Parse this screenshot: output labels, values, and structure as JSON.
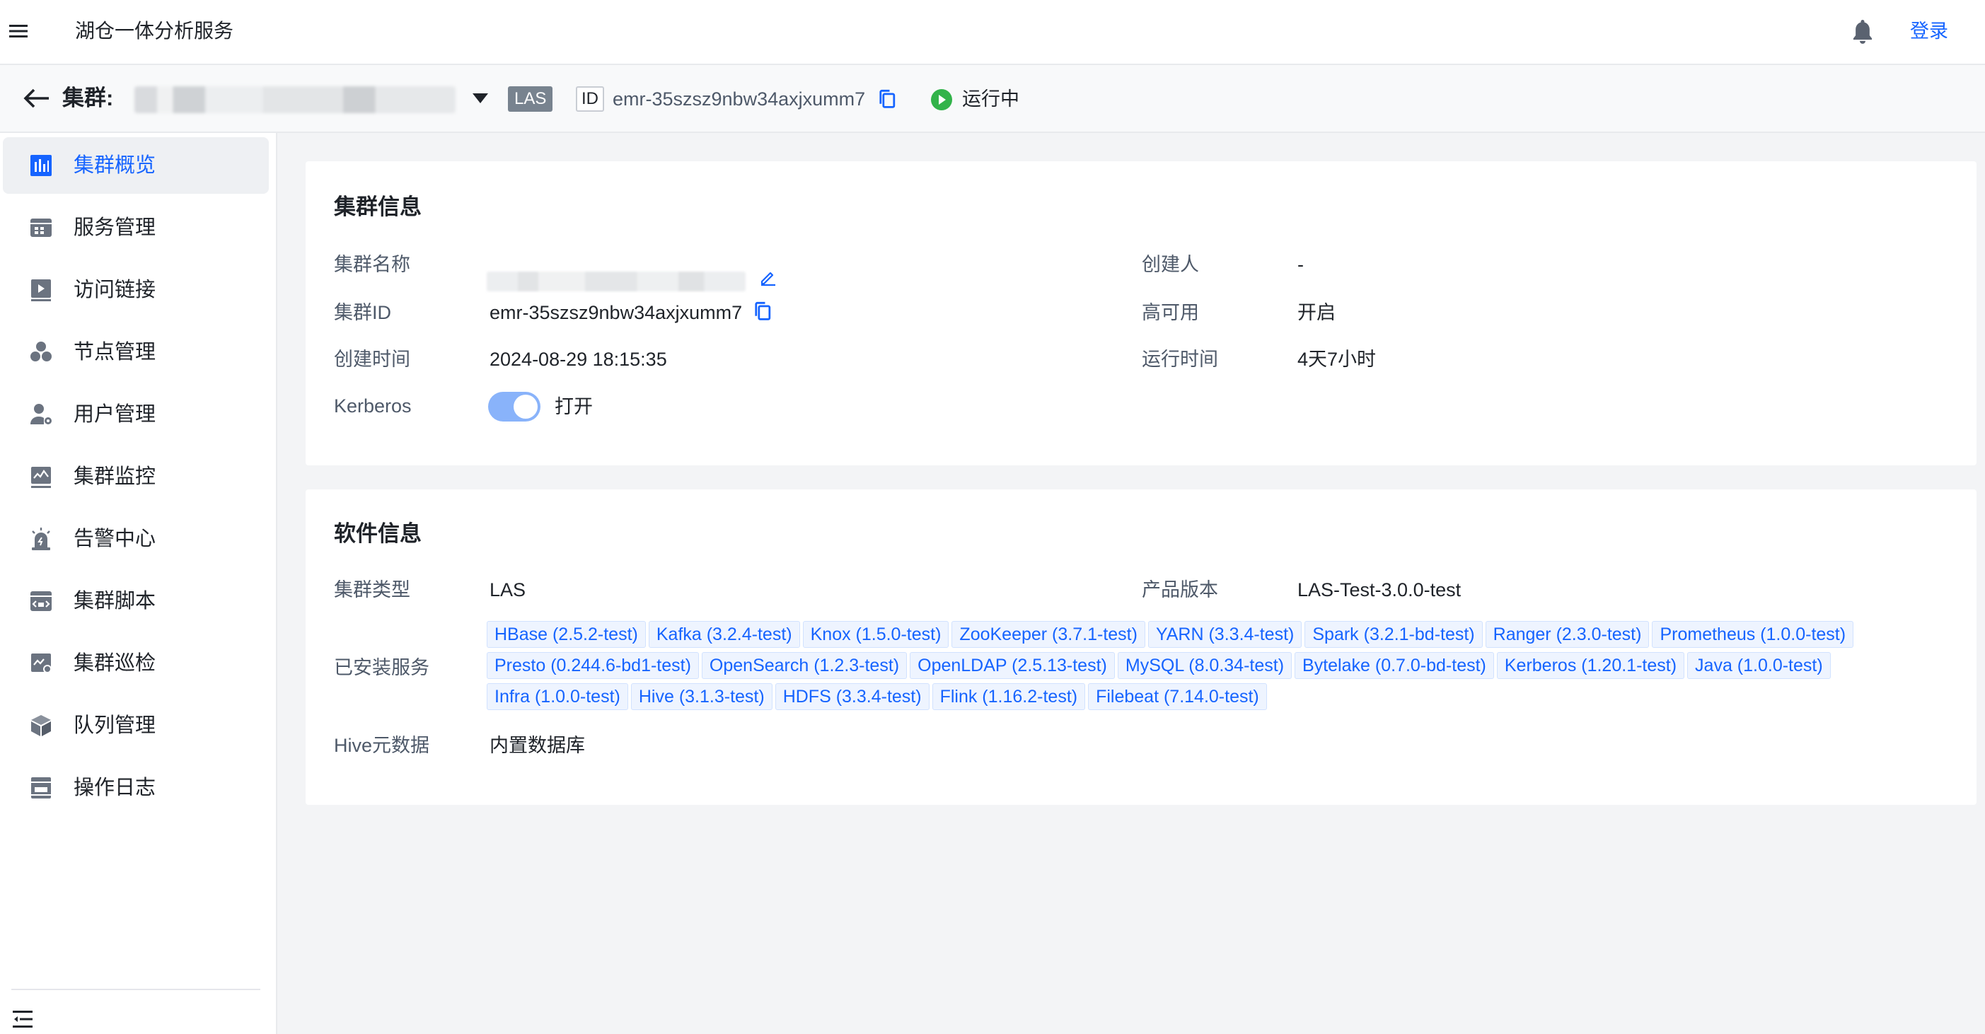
{
  "app": {
    "title": "湖仓一体分析服务",
    "login": "登录"
  },
  "cluster_header": {
    "label": "集群:",
    "type_badge": "LAS",
    "id_badge": "ID",
    "id": "emr-35szsz9nbw34axjxumm7",
    "status": "运行中"
  },
  "sidebar": {
    "items": [
      {
        "label": "集群概览",
        "icon": "chart-bar-icon",
        "active": true
      },
      {
        "label": "服务管理",
        "icon": "service-grid-icon"
      },
      {
        "label": "访问链接",
        "icon": "link-play-icon"
      },
      {
        "label": "节点管理",
        "icon": "nodes-icon"
      },
      {
        "label": "用户管理",
        "icon": "user-gear-icon"
      },
      {
        "label": "集群监控",
        "icon": "monitor-chart-icon"
      },
      {
        "label": "告警中心",
        "icon": "alarm-icon"
      },
      {
        "label": "集群脚本",
        "icon": "script-icon"
      },
      {
        "label": "集群巡检",
        "icon": "inspection-icon"
      },
      {
        "label": "队列管理",
        "icon": "cube-icon"
      },
      {
        "label": "操作日志",
        "icon": "log-icon"
      }
    ]
  },
  "cluster_info": {
    "title": "集群信息",
    "name_label": "集群名称",
    "id_label": "集群ID",
    "id_value": "emr-35szsz9nbw34axjxumm7",
    "created_label": "创建时间",
    "created_value": "2024-08-29 18:15:35",
    "kerberos_label": "Kerberos",
    "kerberos_value": "打开",
    "creator_label": "创建人",
    "creator_value": "-",
    "ha_label": "高可用",
    "ha_value": "开启",
    "uptime_label": "运行时间",
    "uptime_value": "4天7小时"
  },
  "software_info": {
    "title": "软件信息",
    "type_label": "集群类型",
    "type_value": "LAS",
    "version_label": "产品版本",
    "version_value": "LAS-Test-3.0.0-test",
    "services_label": "已安装服务",
    "services": [
      "HBase (2.5.2-test)",
      "Kafka (3.2.4-test)",
      "Knox (1.5.0-test)",
      "ZooKeeper (3.7.1-test)",
      "YARN (3.3.4-test)",
      "Spark (3.2.1-bd-test)",
      "Ranger (2.3.0-test)",
      "Prometheus (1.0.0-test)",
      "Presto (0.244.6-bd1-test)",
      "OpenSearch (1.2.3-test)",
      "OpenLDAP (2.5.13-test)",
      "MySQL (8.0.34-test)",
      "Bytelake (0.7.0-bd-test)",
      "Kerberos (1.20.1-test)",
      "Java (1.0.0-test)",
      "Infra (1.0.0-test)",
      "Hive (3.1.3-test)",
      "HDFS (3.3.4-test)",
      "Flink (1.16.2-test)",
      "Filebeat (7.14.0-test)"
    ],
    "hive_label": "Hive元数据",
    "hive_value": "内置数据库"
  },
  "colors": {
    "accent": "#1664ff",
    "status_running": "#32b34a",
    "badge_bg": "#78838f"
  }
}
